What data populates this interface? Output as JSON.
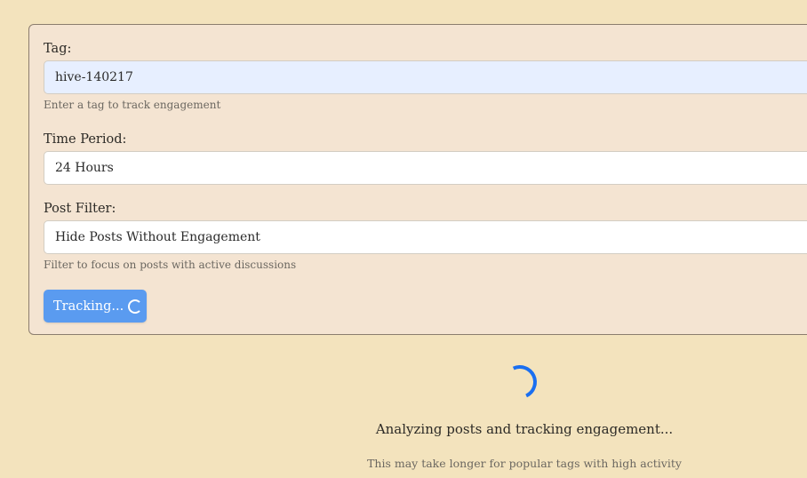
{
  "form": {
    "tag_label": "Tag:",
    "tag_value": "hive-140217",
    "tag_hint": "Enter a tag to track engagement",
    "period_label": "Time Period:",
    "period_value": "24 Hours",
    "filter_label": "Post Filter:",
    "filter_value": "Hide Posts Without Engagement",
    "filter_hint": "Filter to focus on posts with active discussions",
    "submit_label": "Tracking..."
  },
  "loading": {
    "message": "Analyzing posts and tracking engagement...",
    "note": "This may take longer for popular tags with high activity"
  },
  "icons": {
    "button_spinner": "spinner-icon",
    "main_spinner": "loading-spinner-icon"
  },
  "colors": {
    "background": "#f3e3bd",
    "panel": "#f4e4d2",
    "button": "#5a9bf0",
    "spinner": "#1a6ff0"
  }
}
